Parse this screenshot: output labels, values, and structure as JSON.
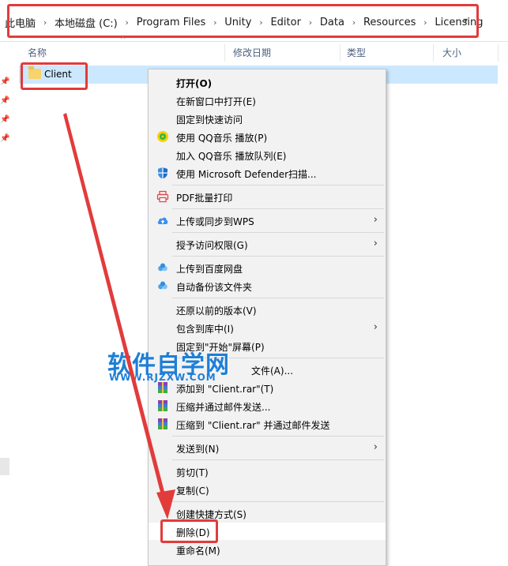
{
  "breadcrumb": {
    "items": [
      "此电脑",
      "本地磁盘 (C:)",
      "Program Files",
      "Unity",
      "Editor",
      "Data",
      "Resources",
      "Licensing"
    ]
  },
  "columns": {
    "name": "名称",
    "modified": "修改日期",
    "type": "类型",
    "size": "大小"
  },
  "file": {
    "name": "Client"
  },
  "menu": {
    "open": "打开(O)",
    "open_new_window": "在新窗口中打开(E)",
    "pin_quick_access": "固定到快速访问",
    "qq_play": "使用 QQ音乐 播放(P)",
    "qq_queue": "加入 QQ音乐 播放队列(E)",
    "defender": "使用 Microsoft Defender扫描...",
    "pdf_print": "PDF批量打印",
    "wps_upload": "上传或同步到WPS",
    "grant_access": "授予访问权限(G)",
    "baidu_upload": "上传到百度网盘",
    "baidu_backup": "自动备份该文件夹",
    "restore": "还原以前的版本(V)",
    "include_library": "包含到库中(I)",
    "pin_start": "固定到\"开始\"屏幕(P)",
    "add_archive_files": "文件(A)...",
    "add_client_rar": "添加到 \"Client.rar\"(T)",
    "compress_email": "压缩并通过邮件发送...",
    "compress_rar_email": "压缩到 \"Client.rar\" 并通过邮件发送",
    "send_to": "发送到(N)",
    "cut": "剪切(T)",
    "copy": "复制(C)",
    "create_shortcut": "创建快捷方式(S)",
    "delete": "删除(D)",
    "rename": "重命名(M)"
  },
  "watermark": {
    "title": "软件自学网",
    "url": "WWW.RJZXW.COM"
  },
  "colors": {
    "annotation_red": "#e23b3b",
    "selection": "#cce8ff",
    "watermark_blue": "#1e7fd6"
  }
}
